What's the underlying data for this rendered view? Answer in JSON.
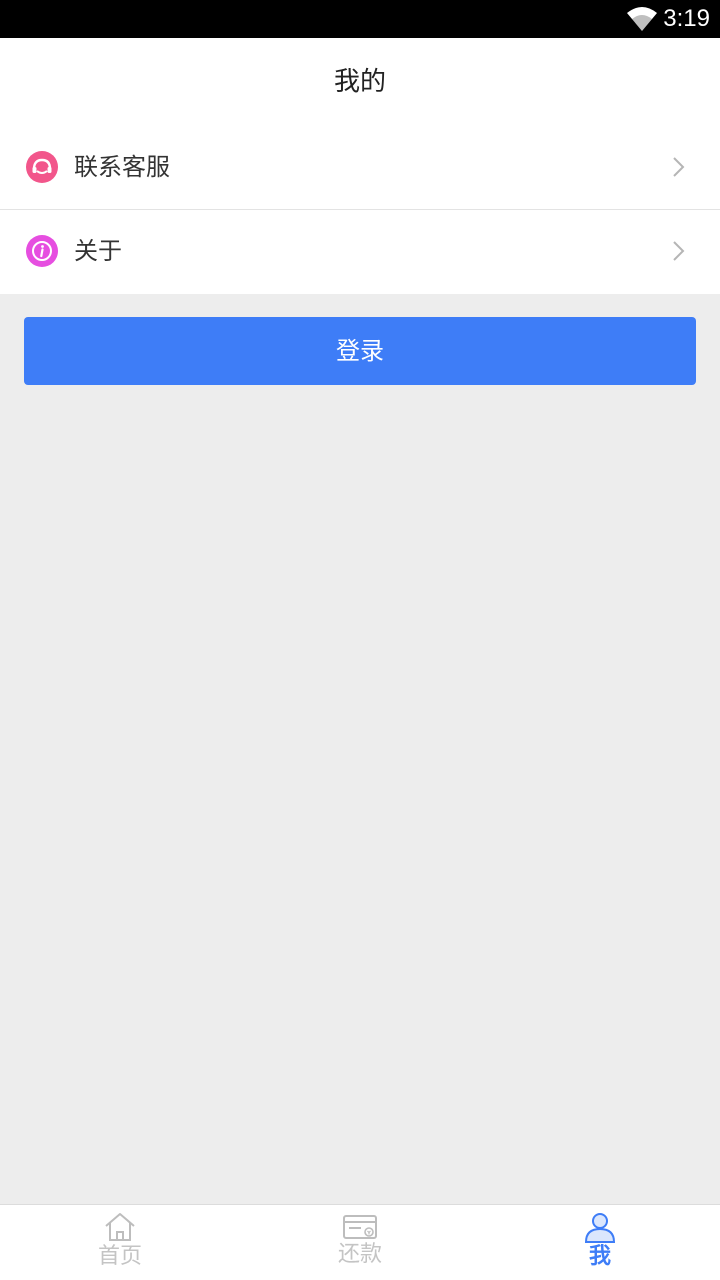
{
  "status_bar": {
    "time": "3:19",
    "wifi_icon": "wifi-icon"
  },
  "header": {
    "title": "我的"
  },
  "menu": {
    "items": [
      {
        "label": "联系客服",
        "icon": "customer-service-icon",
        "icon_color": "#f2568b"
      },
      {
        "label": "关于",
        "icon": "info-icon",
        "icon_color": "#e64ee0"
      }
    ]
  },
  "login": {
    "label": "登录",
    "color": "#3e7df7"
  },
  "tabs": [
    {
      "label": "首页",
      "icon": "home-icon",
      "active": false
    },
    {
      "label": "还款",
      "icon": "repay-card-icon",
      "active": false
    },
    {
      "label": "我",
      "icon": "user-icon",
      "active": true
    }
  ],
  "colors": {
    "accent": "#3e7df7",
    "inactive_tab": "#c4c4c4",
    "background": "#ededed"
  }
}
